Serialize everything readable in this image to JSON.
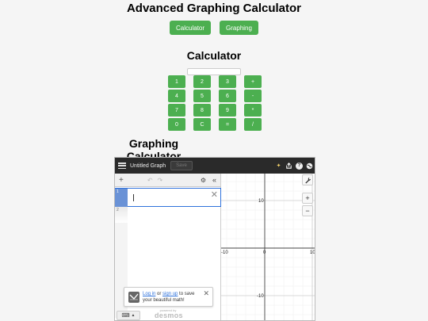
{
  "page": {
    "title": "Advanced Graphing Calculator",
    "mode_buttons": [
      "Calculator",
      "Graphing"
    ],
    "calculator_heading": "Calculator",
    "graphing_heading": "Graphing Calculator"
  },
  "calculator": {
    "display_value": "",
    "keys": [
      "1",
      "2",
      "3",
      "+",
      "4",
      "5",
      "6",
      "-",
      "7",
      "8",
      "9",
      "*",
      "0",
      "C",
      "=",
      "/"
    ]
  },
  "desmos": {
    "graph_title": "Untitled Graph",
    "save_label": "Save",
    "expression_indices": [
      "1",
      "2"
    ],
    "login_prompt": {
      "login_link": "Log in",
      "or": " or ",
      "signup_link": "sign up",
      "rest": " to save your beautiful math!"
    },
    "powered_by": "powered by",
    "brand": "desmos",
    "icons": {
      "menu": "hamburger-icon",
      "share": "share-icon",
      "help": "help-icon",
      "language": "globe-icon",
      "wrench": "wrench-icon",
      "zoom_in": "plus-icon",
      "zoom_out": "minus-icon",
      "add": "plus-icon",
      "undo": "undo-icon",
      "redo": "redo-icon",
      "settings": "gear-icon",
      "collapse": "double-chevron-left-icon",
      "keyboard": "keyboard-icon"
    },
    "axis_labels": {
      "x_neg": "-10",
      "origin": "0",
      "x_pos": "10",
      "y_pos": "10",
      "y_neg": "-10"
    }
  },
  "colors": {
    "accent_green": "#4caf50",
    "desmos_bar": "#2a2a2a",
    "desmos_blue": "#2f72dc"
  }
}
